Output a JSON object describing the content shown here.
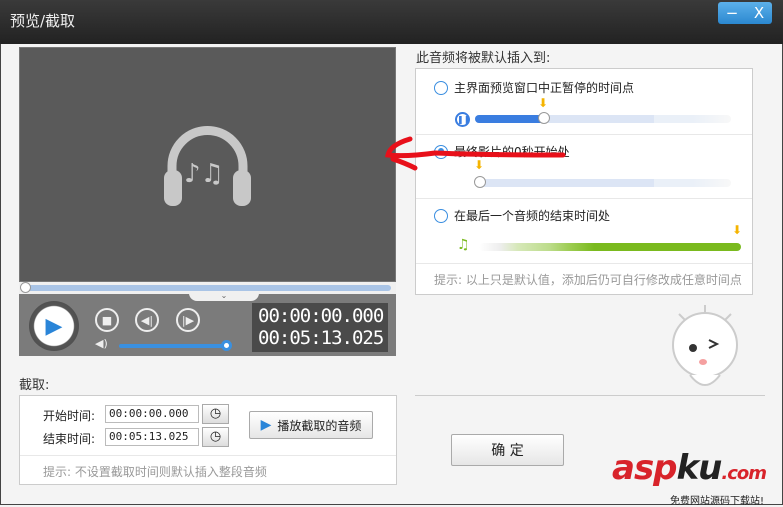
{
  "window": {
    "title": "预览/截取",
    "minimize_label": "−",
    "close_label": "X"
  },
  "player": {
    "current_time": "00:00:00.000",
    "total_time": "00:05:13.025",
    "volume_percent": 100,
    "seek_percent": 0
  },
  "clip": {
    "section_label": "截取:",
    "start_label": "开始时间:",
    "start_value": "00:00:00.000",
    "end_label": "结束时间:",
    "end_value": "00:05:13.025",
    "play_button": "播放截取的音频",
    "hint": "提示: 不设置截取时间则默认插入整段音频"
  },
  "insert": {
    "section_label": "此音频将被默认插入到:",
    "options": [
      {
        "label": "主界面预览窗口中正暂停的时间点",
        "selected": false
      },
      {
        "label": "最终影片的0秒开始处",
        "selected": true
      },
      {
        "label": "在最后一个音频的结束时间处",
        "selected": false
      }
    ],
    "hint": "提示: 以上只是默认值，添加后仍可自行修改成任意时间点"
  },
  "confirm_label": "确 定",
  "watermark": {
    "brand": "aspku.com",
    "slogan": "免费网站源码下载站!"
  },
  "colors": {
    "accent": "#3a8ee0",
    "green": "#7aba1e",
    "arrow": "#f5b400",
    "annotation": "#e8101a"
  }
}
